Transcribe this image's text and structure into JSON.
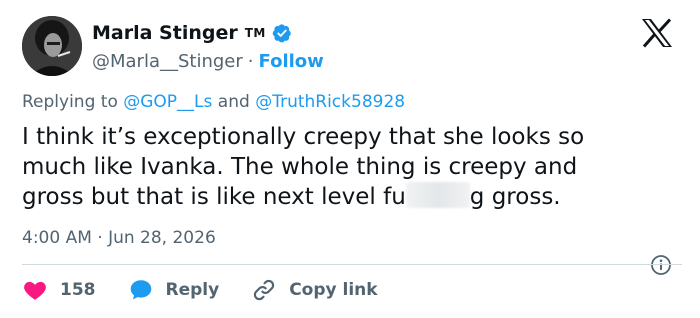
{
  "author": {
    "display_name": "Marla Stinger",
    "tm_label": "TM",
    "handle": "@Marla__Stinger",
    "separator": "·",
    "follow_label": "Follow",
    "verified": true
  },
  "reply_context": {
    "prefix": "Replying to ",
    "mention1": "@GOP__Ls",
    "conjunction": " and ",
    "mention2": "@TruthRick58928"
  },
  "tweet": {
    "line1": "I think it’s exceptionally creepy that she looks so",
    "line2": "much like Ivanka.  The whole thing is creepy and",
    "line3_start": "gross but that is like next level fu",
    "line3_end": "g gross."
  },
  "timestamp": "4:00 AM · Jun 28, 2026",
  "actions": {
    "like_count": "158",
    "reply_label": "Reply",
    "copy_link_label": "Copy link"
  },
  "colors": {
    "accent": "#1d9bf0",
    "like": "#f91880",
    "text": "#0f1419",
    "muted": "#536471"
  },
  "icons": [
    "verified-badge-icon",
    "x-logo-icon",
    "info-icon",
    "heart-icon",
    "reply-bubble-icon",
    "link-icon"
  ]
}
